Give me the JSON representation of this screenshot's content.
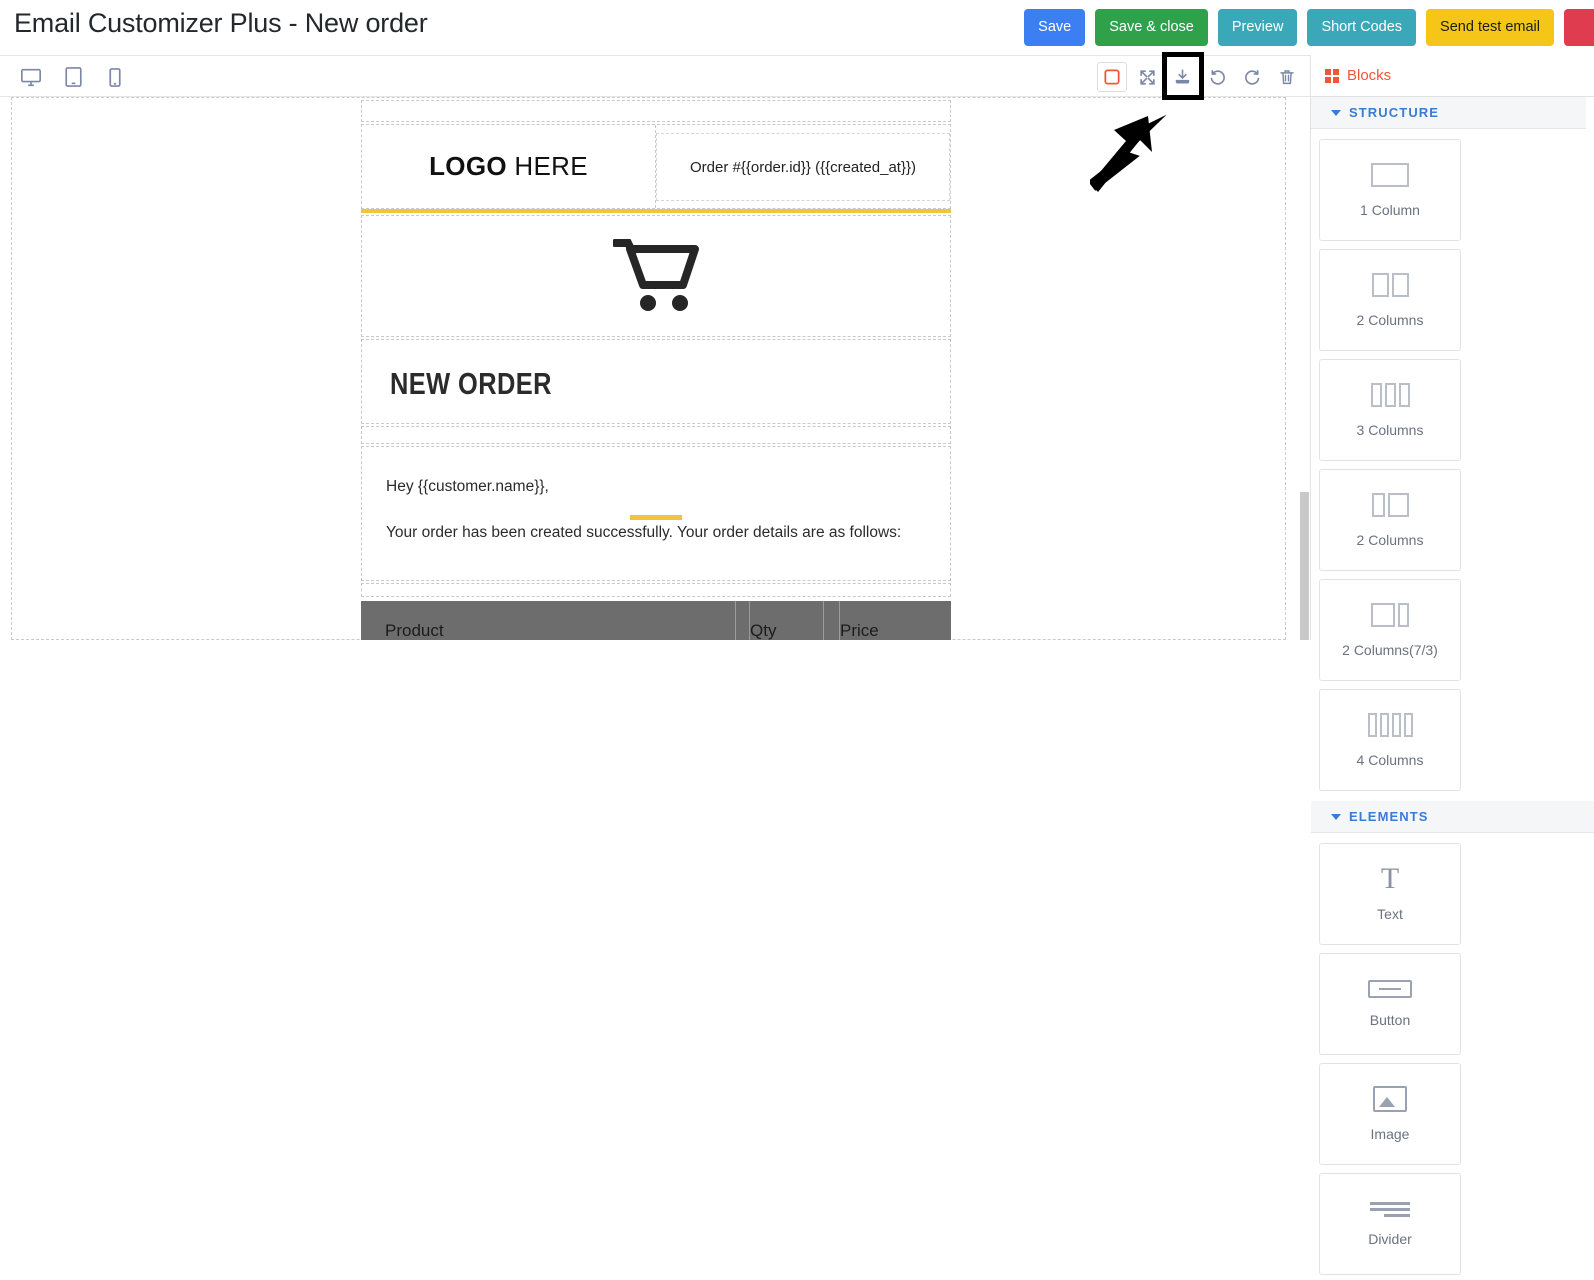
{
  "header": {
    "title": "Email Customizer Plus - New order",
    "actions": [
      {
        "label": "Save",
        "name": "save-button",
        "style": "tb-save"
      },
      {
        "label": "Save & close",
        "name": "save-and-close-button",
        "style": "tb-saveclose"
      },
      {
        "label": "Preview",
        "name": "preview-button",
        "style": "tb-preview"
      },
      {
        "label": "Short Codes",
        "name": "short-codes-button",
        "style": "tb-shortcodes"
      },
      {
        "label": "Send test email",
        "name": "send-test-email-button",
        "style": "tb-sendtest"
      },
      {
        "label": "",
        "name": "reset-button",
        "style": "tb-danger"
      }
    ]
  },
  "toolbar": {
    "devices": [
      {
        "icon": "desktop-icon",
        "name": "device-desktop-button"
      },
      {
        "icon": "tablet-icon",
        "name": "device-tablet-button"
      },
      {
        "icon": "mobile-icon",
        "name": "device-mobile-button"
      }
    ],
    "panel_tools": [
      {
        "icon": "borders-toggle-icon",
        "name": "toggle-borders-button"
      },
      {
        "icon": "fullscreen-icon",
        "name": "fullscreen-button"
      },
      {
        "icon": "import-download-icon",
        "name": "import-template-button"
      },
      {
        "icon": "undo-icon",
        "name": "undo-button"
      },
      {
        "icon": "redo-icon",
        "name": "redo-button"
      },
      {
        "icon": "trash-icon",
        "name": "clear-canvas-button"
      }
    ]
  },
  "email": {
    "logo_bold": "LOGO",
    "logo_light": " HERE",
    "order_line": "Order #{{order.id}} ({{created_at}})",
    "cart_icon": "shopping-cart-icon",
    "heading": "NEW ORDER",
    "body_lines": [
      "Hey {{customer.name}},",
      "Your order has been created successfully. Your order details are as follows:"
    ],
    "table_headers": [
      "Product",
      "Qty",
      "Price"
    ],
    "accent_color": "#f2c33c"
  },
  "right_panel": {
    "tab_label": "Blocks",
    "tab_icon": "grid-icon",
    "sections": [
      {
        "label": "STRUCTURE",
        "name": "section-structure",
        "tiles": [
          {
            "label": "1 Column",
            "shape": "1"
          },
          {
            "label": "2 Columns",
            "shape": "2"
          },
          {
            "label": "3 Columns",
            "shape": "3"
          },
          {
            "label": "2 Columns",
            "shape": "2b"
          },
          {
            "label": "2 Columns(7/3)",
            "shape": "73"
          },
          {
            "label": "4 Columns",
            "shape": "4"
          }
        ]
      },
      {
        "label": "ELEMENTS",
        "name": "section-elements",
        "tiles": [
          {
            "label": "Text",
            "shape": "text"
          },
          {
            "label": "Button",
            "shape": "button"
          },
          {
            "label": "Image",
            "shape": "image"
          },
          {
            "label": "Divider",
            "shape": "lines"
          }
        ]
      }
    ]
  },
  "annotation": {
    "box_target": "import-template-button",
    "arrow": "pointer-arrow"
  }
}
